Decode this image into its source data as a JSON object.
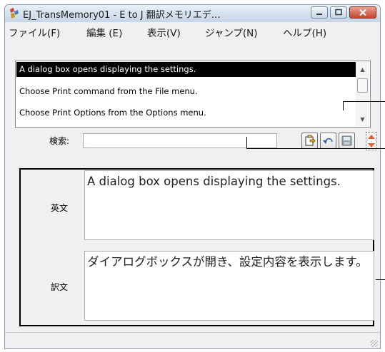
{
  "window": {
    "title": "EJ_TransMemory01 - E to J 翻訳メモリエデ…",
    "colors": {
      "titlebar": "#c5d5e6",
      "close": "#c6452e",
      "selection": "#000000"
    }
  },
  "menu": [
    "ファイル(F)",
    "編集 (E)",
    "表示(V)",
    "ジャンプ(N)",
    "ヘルプ(H)"
  ],
  "sentence_list": {
    "rows": [
      "A dialog box opens displaying the settings.",
      "Choose Print command from the File menu.",
      "Choose Print Options from the Options menu."
    ],
    "selected_index": 0
  },
  "search": {
    "label": "検索:",
    "value": ""
  },
  "toolbar": {
    "icons": [
      "paste-icon",
      "undo-icon",
      "save-icon",
      "prev-next-icon"
    ]
  },
  "editor": {
    "source_label": "英文",
    "source_text": "A dialog box opens displaying the settings.",
    "target_label": "訳文",
    "target_text": "ダイアログボックスが開き、設定内容を表示します。"
  }
}
